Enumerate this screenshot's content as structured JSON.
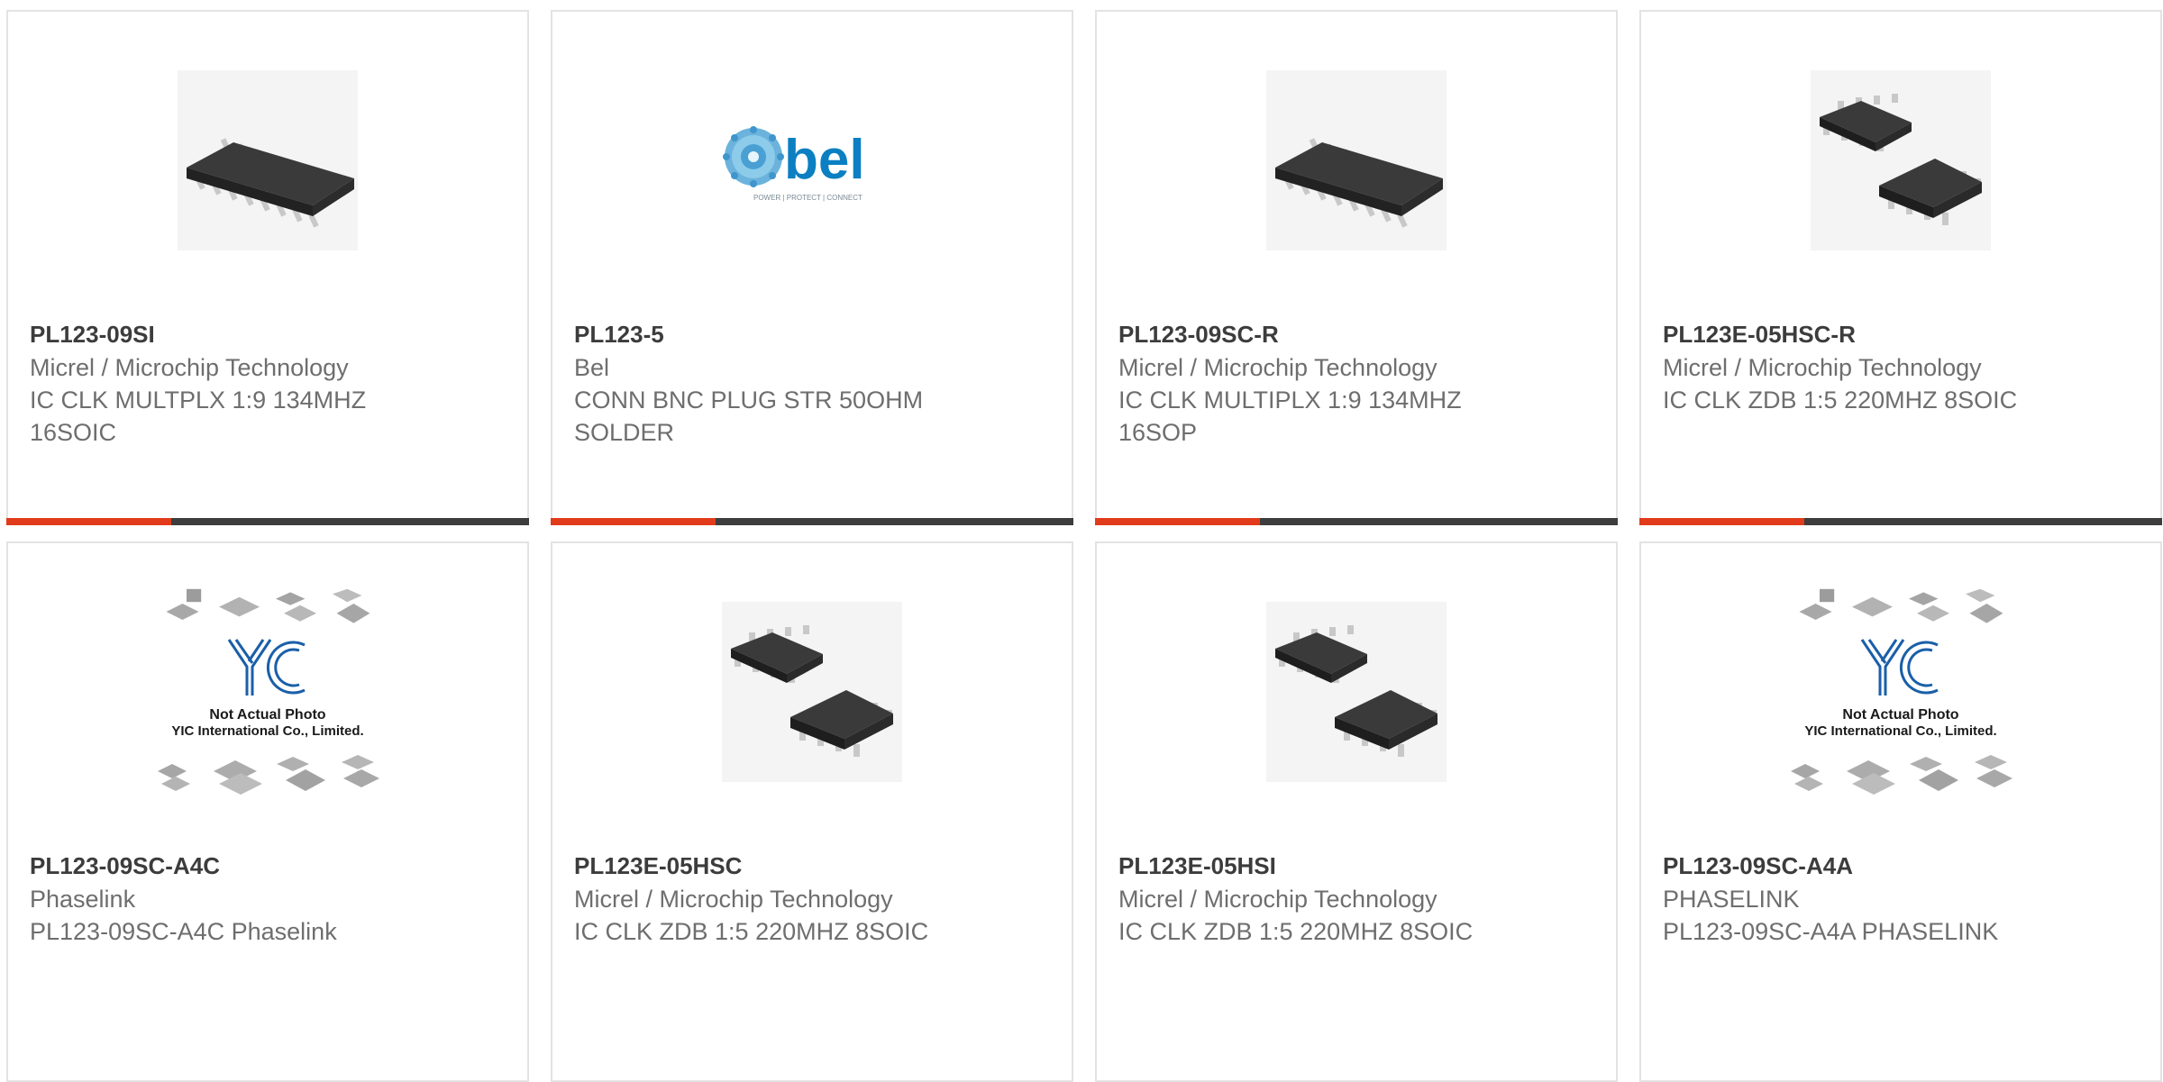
{
  "colors": {
    "accent": "#e23b1b",
    "bar_dark": "#3d3d3d",
    "part_number": "#3c3c3c",
    "text": "#6e6e6e",
    "border": "#e3e3e3"
  },
  "yic": {
    "line1": "Not Actual Photo",
    "line2": "YIC International Co., Limited."
  },
  "bel_logo": {
    "text": "bel",
    "tagline": "POWER | PROTECT | CONNECT"
  },
  "products": [
    {
      "part_number": "PL123-09SI",
      "manufacturer": "Micrel / Microchip Technology",
      "description": "IC CLK MULTPLX 1:9 134MHZ 16SOIC",
      "image": "soic-16-chip-icon"
    },
    {
      "part_number": "PL123-5",
      "manufacturer": "Bel",
      "description": "CONN BNC PLUG STR 50OHM SOLDER",
      "image": "bel-logo"
    },
    {
      "part_number": "PL123-09SC-R",
      "manufacturer": "Micrel / Microchip Technology",
      "description": "IC CLK MULTIPLX 1:9 134MHZ 16SOP",
      "image": "soic-16-chip-icon"
    },
    {
      "part_number": "PL123E-05HSC-R",
      "manufacturer": "Micrel / Microchip Technology",
      "description": "IC CLK ZDB 1:5 220MHZ 8SOIC",
      "image": "soic-8-chips-icon"
    },
    {
      "part_number": "PL123-09SC-A4C",
      "manufacturer": "Phaselink",
      "description": "PL123-09SC-A4C Phaselink",
      "image": "yic-placeholder"
    },
    {
      "part_number": "PL123E-05HSC",
      "manufacturer": "Micrel / Microchip Technology",
      "description": "IC CLK ZDB 1:5 220MHZ 8SOIC",
      "image": "soic-8-chips-icon"
    },
    {
      "part_number": "PL123E-05HSI",
      "manufacturer": "Micrel / Microchip Technology",
      "description": "IC CLK ZDB 1:5 220MHZ 8SOIC",
      "image": "soic-8-chips-icon"
    },
    {
      "part_number": "PL123-09SC-A4A",
      "manufacturer": "PHASELINK",
      "description": "PL123-09SC-A4A PHASELINK",
      "image": "yic-placeholder"
    }
  ]
}
